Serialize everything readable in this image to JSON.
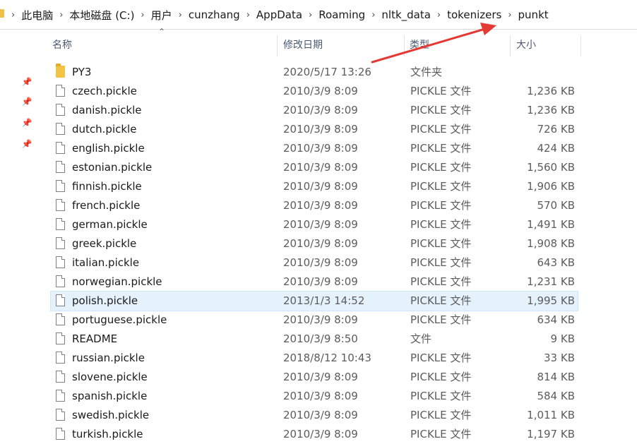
{
  "breadcrumb": [
    "此电脑",
    "本地磁盘 (C:)",
    "用户",
    "cunzhang",
    "AppData",
    "Roaming",
    "nltk_data",
    "tokenizers",
    "punkt"
  ],
  "columns": {
    "name": "名称",
    "date": "修改日期",
    "type": "类型",
    "size": "大小"
  },
  "colors": {
    "selected_row": "#e5f1fb",
    "annotation_arrow": "#e53935",
    "folder": "#f3c344"
  },
  "files": [
    {
      "name": "PY3",
      "date": "2020/5/17 13:26",
      "type": "文件夹",
      "size": "",
      "icon": "folder-icon"
    },
    {
      "name": "czech.pickle",
      "date": "2010/3/9 8:09",
      "type": "PICKLE 文件",
      "size": "1,236 KB",
      "icon": "file-icon"
    },
    {
      "name": "danish.pickle",
      "date": "2010/3/9 8:09",
      "type": "PICKLE 文件",
      "size": "1,236 KB",
      "icon": "file-icon"
    },
    {
      "name": "dutch.pickle",
      "date": "2010/3/9 8:09",
      "type": "PICKLE 文件",
      "size": "726 KB",
      "icon": "file-icon"
    },
    {
      "name": "english.pickle",
      "date": "2010/3/9 8:09",
      "type": "PICKLE 文件",
      "size": "424 KB",
      "icon": "file-icon"
    },
    {
      "name": "estonian.pickle",
      "date": "2010/3/9 8:09",
      "type": "PICKLE 文件",
      "size": "1,560 KB",
      "icon": "file-icon"
    },
    {
      "name": "finnish.pickle",
      "date": "2010/3/9 8:09",
      "type": "PICKLE 文件",
      "size": "1,906 KB",
      "icon": "file-icon"
    },
    {
      "name": "french.pickle",
      "date": "2010/3/9 8:09",
      "type": "PICKLE 文件",
      "size": "570 KB",
      "icon": "file-icon"
    },
    {
      "name": "german.pickle",
      "date": "2010/3/9 8:09",
      "type": "PICKLE 文件",
      "size": "1,491 KB",
      "icon": "file-icon"
    },
    {
      "name": "greek.pickle",
      "date": "2010/3/9 8:09",
      "type": "PICKLE 文件",
      "size": "1,908 KB",
      "icon": "file-icon"
    },
    {
      "name": "italian.pickle",
      "date": "2010/3/9 8:09",
      "type": "PICKLE 文件",
      "size": "643 KB",
      "icon": "file-icon"
    },
    {
      "name": "norwegian.pickle",
      "date": "2010/3/9 8:09",
      "type": "PICKLE 文件",
      "size": "1,231 KB",
      "icon": "file-icon"
    },
    {
      "name": "polish.pickle",
      "date": "2013/1/3 14:52",
      "type": "PICKLE 文件",
      "size": "1,995 KB",
      "icon": "file-icon",
      "selected": true
    },
    {
      "name": "portuguese.pickle",
      "date": "2010/3/9 8:09",
      "type": "PICKLE 文件",
      "size": "634 KB",
      "icon": "file-icon"
    },
    {
      "name": "README",
      "date": "2010/3/9 8:50",
      "type": "文件",
      "size": "9 KB",
      "icon": "file-icon"
    },
    {
      "name": "russian.pickle",
      "date": "2018/8/12 10:43",
      "type": "PICKLE 文件",
      "size": "33 KB",
      "icon": "file-icon"
    },
    {
      "name": "slovene.pickle",
      "date": "2010/3/9 8:09",
      "type": "PICKLE 文件",
      "size": "814 KB",
      "icon": "file-icon"
    },
    {
      "name": "spanish.pickle",
      "date": "2010/3/9 8:09",
      "type": "PICKLE 文件",
      "size": "584 KB",
      "icon": "file-icon"
    },
    {
      "name": "swedish.pickle",
      "date": "2010/3/9 8:09",
      "type": "PICKLE 文件",
      "size": "1,011 KB",
      "icon": "file-icon"
    },
    {
      "name": "turkish.pickle",
      "date": "2010/3/9 8:09",
      "type": "PICKLE 文件",
      "size": "1,197 KB",
      "icon": "file-icon"
    }
  ]
}
